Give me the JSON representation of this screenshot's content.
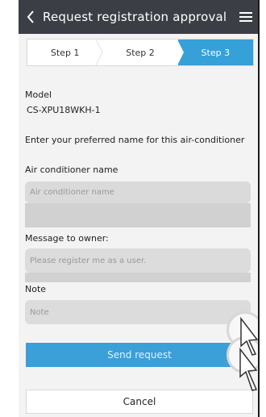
{
  "header": {
    "title": "Request registration approval",
    "back_icon": "chevron-left-icon",
    "menu_icon": "menu-icon"
  },
  "steps": {
    "items": [
      "Step 1",
      "Step 2",
      "Step 3"
    ],
    "active_index": 2,
    "accent": "#36a0d9"
  },
  "form": {
    "model_label": "Model",
    "model_value": "CS-XPU18WKH-1",
    "instruction": "Enter your preferred name for this air-conditioner",
    "ac_name_label": "Air conditioner name",
    "ac_name_placeholder": "Air conditioner name",
    "message_label": "Message to owner:",
    "message_placeholder": "Please register me as a user.",
    "note_label": "Note",
    "note_placeholder": "Note"
  },
  "actions": {
    "send": "Send request",
    "cancel": "Cancel"
  }
}
